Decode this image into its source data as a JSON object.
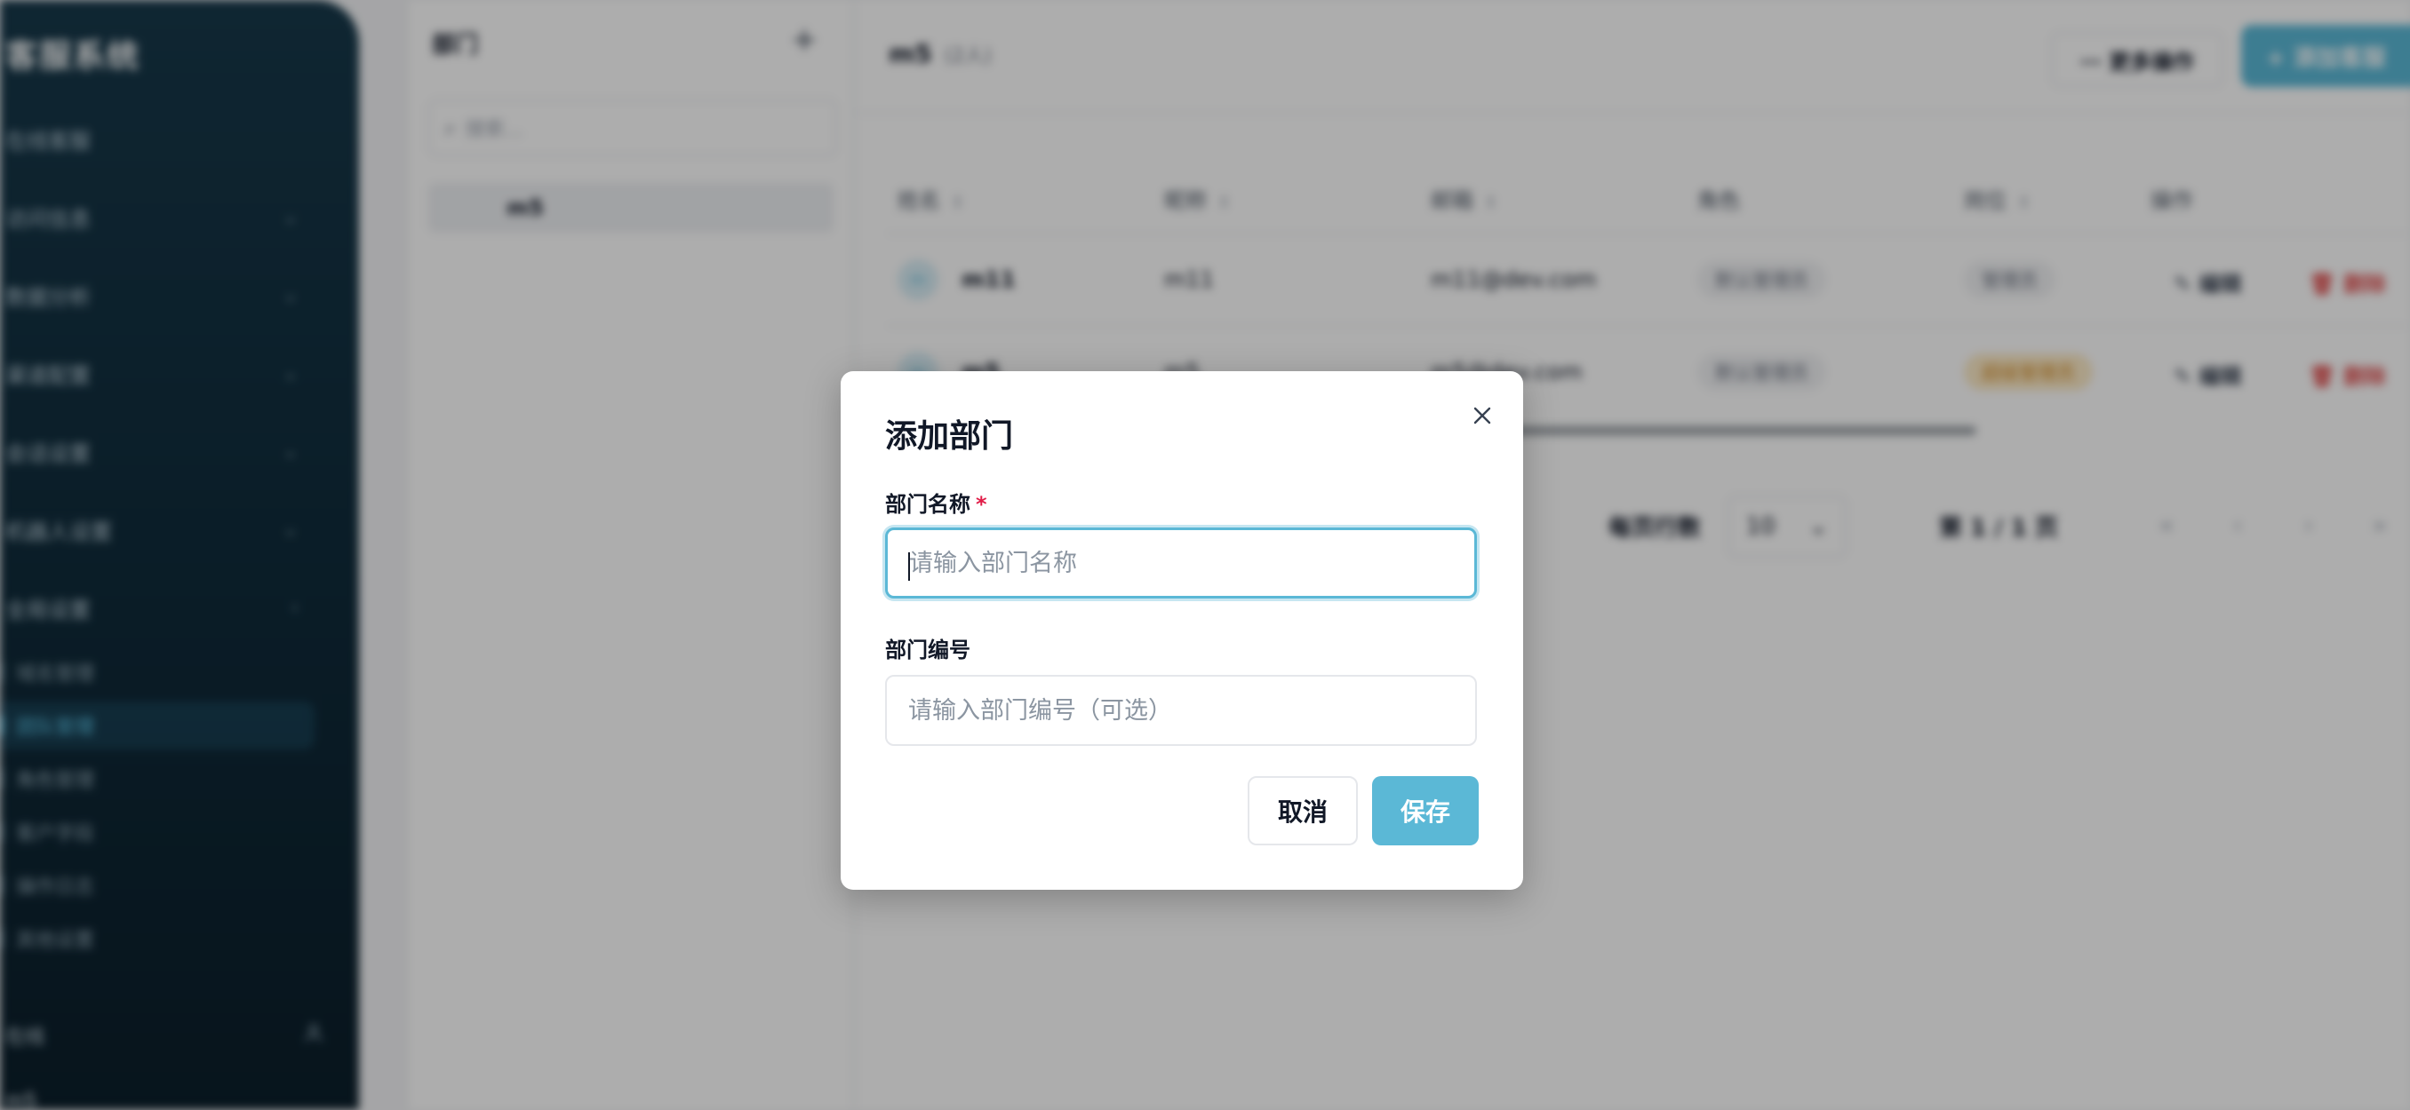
{
  "colors": {
    "accent": "#5bb8d6",
    "sidebar_bg": "#0f2a39",
    "danger": "#e05252",
    "required": "#e11d48"
  },
  "sidebar": {
    "brand": "客服系统",
    "items": [
      {
        "label": "在线客服"
      },
      {
        "label": "访问信息"
      },
      {
        "label": "数据分析"
      },
      {
        "label": "渠道配置"
      },
      {
        "label": "会话设置"
      },
      {
        "label": "机器人设置"
      },
      {
        "label": "全局设置"
      }
    ],
    "sub_items": [
      {
        "label": "域名管理"
      },
      {
        "label": "团队管理"
      },
      {
        "label": "角色管理"
      },
      {
        "label": "客户字段"
      },
      {
        "label": "操作日志"
      },
      {
        "label": "其他设置"
      }
    ],
    "footer_label": "在线",
    "footer_icon": "user-icon",
    "user": "m5"
  },
  "dept_panel": {
    "title": "部门",
    "add_icon": "+",
    "search_placeholder": "搜索...",
    "departments": [
      {
        "name": "m5"
      }
    ]
  },
  "main": {
    "title": "m5",
    "count": "(2人)",
    "more_actions": "⋯ 更多操作",
    "add_agent": "+ 添加客服",
    "table": {
      "headers": [
        "姓名",
        "昵称",
        "邮箱",
        "角色",
        "岗位",
        "操作"
      ],
      "rows": [
        {
          "avatar": "m",
          "name": "m11",
          "nickname": "m11",
          "email": "m11@dev.com",
          "role": "默认管理员",
          "position": "管理员"
        },
        {
          "avatar": "m",
          "name": "m5",
          "nickname": "m5",
          "email": "m5@dev.com",
          "role": "默认管理员",
          "position": "超级管理员"
        }
      ],
      "edit_label": "编辑",
      "delete_label": "删除"
    },
    "pagination": {
      "rows_per_page_label": "每页行数",
      "rows_per_page": "10",
      "page_info": "第 1 / 1 页"
    }
  },
  "modal": {
    "title": "添加部门",
    "name_label": "部门名称",
    "required_mark": "*",
    "name_placeholder": "请输入部门名称",
    "name_value": "",
    "code_label": "部门编号",
    "code_placeholder": "请输入部门编号（可选）",
    "code_value": "",
    "cancel": "取消",
    "save": "保存"
  }
}
